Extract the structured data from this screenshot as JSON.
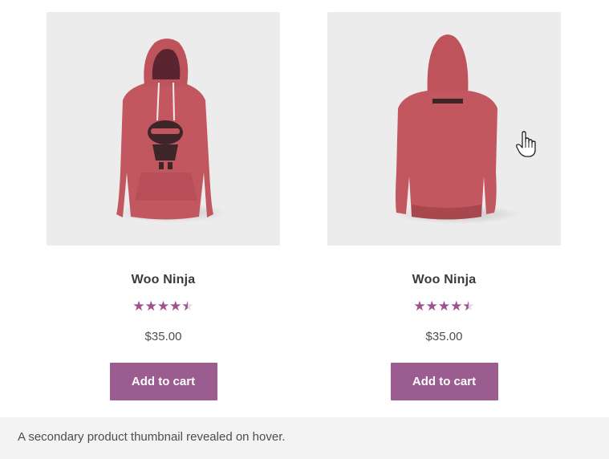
{
  "products": [
    {
      "image": "pink-hoodie-front-ninja-logo",
      "title": "Woo Ninja",
      "rating": 4.5,
      "rating_max": 5,
      "price": "$35.00",
      "button_label": "Add to cart"
    },
    {
      "image": "pink-hoodie-back-hover",
      "title": "Woo Ninja",
      "rating": 4.5,
      "rating_max": 5,
      "price": "$35.00",
      "button_label": "Add to cart"
    }
  ],
  "caption": "A secondary product thumbnail revealed on hover.",
  "colors": {
    "accent": "#9b5c8f",
    "star": "#a0528e",
    "hoodie": "#c3575f",
    "thumb_bg": "#ececec",
    "caption_bg": "#f3f3f3"
  },
  "icons": {
    "cursor": "hand-pointer-icon",
    "star": "star-icon"
  }
}
